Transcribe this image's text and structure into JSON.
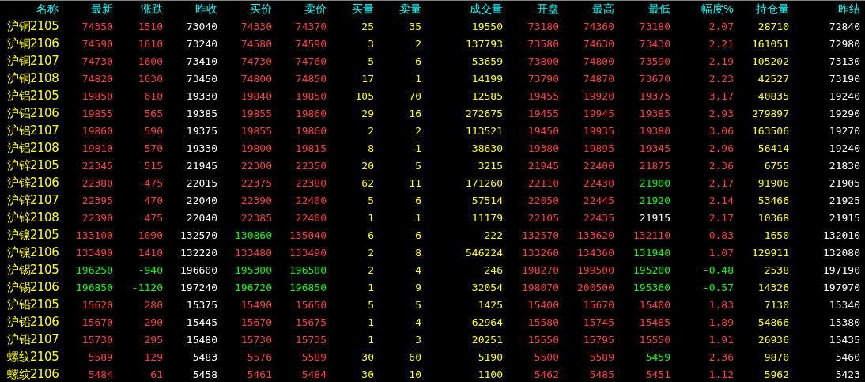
{
  "columns": [
    {
      "label": "名称"
    },
    {
      "label": "最新"
    },
    {
      "label": "涨跌"
    },
    {
      "label": "昨收"
    },
    {
      "label": "买价"
    },
    {
      "label": "卖价"
    },
    {
      "label": "买量"
    },
    {
      "label": "卖量"
    },
    {
      "label": "成交量"
    },
    {
      "label": "开盘"
    },
    {
      "label": "最高"
    },
    {
      "label": "最低"
    },
    {
      "label": "幅度%"
    },
    {
      "label": "持仓量"
    },
    {
      "label": "昨结"
    }
  ],
  "rows": [
    {
      "name": "沪铜2105",
      "cells": [
        {
          "text": "74350",
          "color": "#ff3c3c"
        },
        {
          "text": "1510",
          "color": "#ff3c3c"
        },
        {
          "text": "73040",
          "color": "#ffffff"
        },
        {
          "text": "74330",
          "color": "#ff3c3c"
        },
        {
          "text": "74370",
          "color": "#ff3c3c"
        },
        {
          "text": "25",
          "color": "#ffff00"
        },
        {
          "text": "35",
          "color": "#ffff00"
        },
        {
          "text": "19550",
          "color": "#ffff00"
        },
        {
          "text": "73180",
          "color": "#ff3c3c"
        },
        {
          "text": "74360",
          "color": "#ff3c3c"
        },
        {
          "text": "73180",
          "color": "#ff3c3c"
        },
        {
          "text": "2.07",
          "color": "#ff3c3c"
        },
        {
          "text": "28710",
          "color": "#ffff00"
        },
        {
          "text": "72840",
          "color": "#ffffff"
        }
      ]
    },
    {
      "name": "沪铜2106",
      "cells": [
        {
          "text": "74590",
          "color": "#ff3c3c"
        },
        {
          "text": "1610",
          "color": "#ff3c3c"
        },
        {
          "text": "73240",
          "color": "#ffffff"
        },
        {
          "text": "74580",
          "color": "#ff3c3c"
        },
        {
          "text": "74590",
          "color": "#ff3c3c"
        },
        {
          "text": "3",
          "color": "#ffff00"
        },
        {
          "text": "2",
          "color": "#ffff00"
        },
        {
          "text": "137793",
          "color": "#ffff00"
        },
        {
          "text": "73580",
          "color": "#ff3c3c"
        },
        {
          "text": "74630",
          "color": "#ff3c3c"
        },
        {
          "text": "73430",
          "color": "#ff3c3c"
        },
        {
          "text": "2.21",
          "color": "#ff3c3c"
        },
        {
          "text": "161051",
          "color": "#ffff00"
        },
        {
          "text": "72980",
          "color": "#ffffff"
        }
      ]
    },
    {
      "name": "沪铜2107",
      "cells": [
        {
          "text": "74730",
          "color": "#ff3c3c"
        },
        {
          "text": "1600",
          "color": "#ff3c3c"
        },
        {
          "text": "73410",
          "color": "#ffffff"
        },
        {
          "text": "74730",
          "color": "#ff3c3c"
        },
        {
          "text": "74760",
          "color": "#ff3c3c"
        },
        {
          "text": "5",
          "color": "#ffff00"
        },
        {
          "text": "6",
          "color": "#ffff00"
        },
        {
          "text": "53659",
          "color": "#ffff00"
        },
        {
          "text": "73800",
          "color": "#ff3c3c"
        },
        {
          "text": "74800",
          "color": "#ff3c3c"
        },
        {
          "text": "73590",
          "color": "#ff3c3c"
        },
        {
          "text": "2.19",
          "color": "#ff3c3c"
        },
        {
          "text": "105202",
          "color": "#ffff00"
        },
        {
          "text": "73130",
          "color": "#ffffff"
        }
      ]
    },
    {
      "name": "沪铜2108",
      "cells": [
        {
          "text": "74820",
          "color": "#ff3c3c"
        },
        {
          "text": "1630",
          "color": "#ff3c3c"
        },
        {
          "text": "73450",
          "color": "#ffffff"
        },
        {
          "text": "74800",
          "color": "#ff3c3c"
        },
        {
          "text": "74850",
          "color": "#ff3c3c"
        },
        {
          "text": "17",
          "color": "#ffff00"
        },
        {
          "text": "1",
          "color": "#ffff00"
        },
        {
          "text": "14199",
          "color": "#ffff00"
        },
        {
          "text": "73790",
          "color": "#ff3c3c"
        },
        {
          "text": "74870",
          "color": "#ff3c3c"
        },
        {
          "text": "73670",
          "color": "#ff3c3c"
        },
        {
          "text": "2.23",
          "color": "#ff3c3c"
        },
        {
          "text": "42527",
          "color": "#ffff00"
        },
        {
          "text": "73190",
          "color": "#ffffff"
        }
      ]
    },
    {
      "name": "沪铝2105",
      "cells": [
        {
          "text": "19850",
          "color": "#ff3c3c"
        },
        {
          "text": "610",
          "color": "#ff3c3c"
        },
        {
          "text": "19330",
          "color": "#ffffff"
        },
        {
          "text": "19840",
          "color": "#ff3c3c"
        },
        {
          "text": "19850",
          "color": "#ff3c3c"
        },
        {
          "text": "105",
          "color": "#ffff00"
        },
        {
          "text": "70",
          "color": "#ffff00"
        },
        {
          "text": "12585",
          "color": "#ffff00"
        },
        {
          "text": "19455",
          "color": "#ff3c3c"
        },
        {
          "text": "19920",
          "color": "#ff3c3c"
        },
        {
          "text": "19375",
          "color": "#ff3c3c"
        },
        {
          "text": "3.17",
          "color": "#ff3c3c"
        },
        {
          "text": "40835",
          "color": "#ffff00"
        },
        {
          "text": "19240",
          "color": "#ffffff"
        }
      ]
    },
    {
      "name": "沪铝2106",
      "cells": [
        {
          "text": "19855",
          "color": "#ff3c3c"
        },
        {
          "text": "565",
          "color": "#ff3c3c"
        },
        {
          "text": "19385",
          "color": "#ffffff"
        },
        {
          "text": "19855",
          "color": "#ff3c3c"
        },
        {
          "text": "19860",
          "color": "#ff3c3c"
        },
        {
          "text": "29",
          "color": "#ffff00"
        },
        {
          "text": "16",
          "color": "#ffff00"
        },
        {
          "text": "272675",
          "color": "#ffff00"
        },
        {
          "text": "19455",
          "color": "#ff3c3c"
        },
        {
          "text": "19945",
          "color": "#ff3c3c"
        },
        {
          "text": "19385",
          "color": "#ff3c3c"
        },
        {
          "text": "2.93",
          "color": "#ff3c3c"
        },
        {
          "text": "279897",
          "color": "#ffff00"
        },
        {
          "text": "19290",
          "color": "#ffffff"
        }
      ]
    },
    {
      "name": "沪铝2107",
      "cells": [
        {
          "text": "19860",
          "color": "#ff3c3c"
        },
        {
          "text": "590",
          "color": "#ff3c3c"
        },
        {
          "text": "19375",
          "color": "#ffffff"
        },
        {
          "text": "19855",
          "color": "#ff3c3c"
        },
        {
          "text": "19860",
          "color": "#ff3c3c"
        },
        {
          "text": "2",
          "color": "#ffff00"
        },
        {
          "text": "2",
          "color": "#ffff00"
        },
        {
          "text": "113521",
          "color": "#ffff00"
        },
        {
          "text": "19450",
          "color": "#ff3c3c"
        },
        {
          "text": "19935",
          "color": "#ff3c3c"
        },
        {
          "text": "19380",
          "color": "#ff3c3c"
        },
        {
          "text": "3.06",
          "color": "#ff3c3c"
        },
        {
          "text": "163506",
          "color": "#ffff00"
        },
        {
          "text": "19270",
          "color": "#ffffff"
        }
      ]
    },
    {
      "name": "沪铝2108",
      "cells": [
        {
          "text": "19810",
          "color": "#ff3c3c"
        },
        {
          "text": "570",
          "color": "#ff3c3c"
        },
        {
          "text": "19330",
          "color": "#ffffff"
        },
        {
          "text": "19800",
          "color": "#ff3c3c"
        },
        {
          "text": "19815",
          "color": "#ff3c3c"
        },
        {
          "text": "8",
          "color": "#ffff00"
        },
        {
          "text": "1",
          "color": "#ffff00"
        },
        {
          "text": "38630",
          "color": "#ffff00"
        },
        {
          "text": "19380",
          "color": "#ff3c3c"
        },
        {
          "text": "19895",
          "color": "#ff3c3c"
        },
        {
          "text": "19345",
          "color": "#ff3c3c"
        },
        {
          "text": "2.96",
          "color": "#ff3c3c"
        },
        {
          "text": "56414",
          "color": "#ffff00"
        },
        {
          "text": "19240",
          "color": "#ffffff"
        }
      ]
    },
    {
      "name": "沪锌2105",
      "cells": [
        {
          "text": "22345",
          "color": "#ff3c3c"
        },
        {
          "text": "515",
          "color": "#ff3c3c"
        },
        {
          "text": "21945",
          "color": "#ffffff"
        },
        {
          "text": "22300",
          "color": "#ff3c3c"
        },
        {
          "text": "22350",
          "color": "#ff3c3c"
        },
        {
          "text": "20",
          "color": "#ffff00"
        },
        {
          "text": "5",
          "color": "#ffff00"
        },
        {
          "text": "3215",
          "color": "#ffff00"
        },
        {
          "text": "21945",
          "color": "#ff3c3c"
        },
        {
          "text": "22400",
          "color": "#ff3c3c"
        },
        {
          "text": "21875",
          "color": "#ff3c3c"
        },
        {
          "text": "2.36",
          "color": "#ff3c3c"
        },
        {
          "text": "6755",
          "color": "#ffff00"
        },
        {
          "text": "21830",
          "color": "#ffffff"
        }
      ]
    },
    {
      "name": "沪锌2106",
      "cells": [
        {
          "text": "22380",
          "color": "#ff3c3c"
        },
        {
          "text": "475",
          "color": "#ff3c3c"
        },
        {
          "text": "22015",
          "color": "#ffffff"
        },
        {
          "text": "22375",
          "color": "#ff3c3c"
        },
        {
          "text": "22380",
          "color": "#ff3c3c"
        },
        {
          "text": "62",
          "color": "#ffff00"
        },
        {
          "text": "11",
          "color": "#ffff00"
        },
        {
          "text": "171260",
          "color": "#ffff00"
        },
        {
          "text": "22110",
          "color": "#ff3c3c"
        },
        {
          "text": "22430",
          "color": "#ff3c3c"
        },
        {
          "text": "21900",
          "color": "#00ff00"
        },
        {
          "text": "2.17",
          "color": "#ff3c3c"
        },
        {
          "text": "91906",
          "color": "#ffff00"
        },
        {
          "text": "21905",
          "color": "#ffffff"
        }
      ]
    },
    {
      "name": "沪锌2107",
      "cells": [
        {
          "text": "22395",
          "color": "#ff3c3c"
        },
        {
          "text": "470",
          "color": "#ff3c3c"
        },
        {
          "text": "22040",
          "color": "#ffffff"
        },
        {
          "text": "22390",
          "color": "#ff3c3c"
        },
        {
          "text": "22400",
          "color": "#ff3c3c"
        },
        {
          "text": "5",
          "color": "#ffff00"
        },
        {
          "text": "6",
          "color": "#ffff00"
        },
        {
          "text": "57514",
          "color": "#ffff00"
        },
        {
          "text": "22050",
          "color": "#ff3c3c"
        },
        {
          "text": "22445",
          "color": "#ff3c3c"
        },
        {
          "text": "21920",
          "color": "#00ff00"
        },
        {
          "text": "2.14",
          "color": "#ff3c3c"
        },
        {
          "text": "53466",
          "color": "#ffff00"
        },
        {
          "text": "21925",
          "color": "#ffffff"
        }
      ]
    },
    {
      "name": "沪锌2108",
      "cells": [
        {
          "text": "22390",
          "color": "#ff3c3c"
        },
        {
          "text": "475",
          "color": "#ff3c3c"
        },
        {
          "text": "22040",
          "color": "#ffffff"
        },
        {
          "text": "22385",
          "color": "#ff3c3c"
        },
        {
          "text": "22400",
          "color": "#ff3c3c"
        },
        {
          "text": "1",
          "color": "#ffff00"
        },
        {
          "text": "1",
          "color": "#ffff00"
        },
        {
          "text": "11179",
          "color": "#ffff00"
        },
        {
          "text": "22105",
          "color": "#ff3c3c"
        },
        {
          "text": "22435",
          "color": "#ff3c3c"
        },
        {
          "text": "21915",
          "color": "#ffffff"
        },
        {
          "text": "2.17",
          "color": "#ff3c3c"
        },
        {
          "text": "10368",
          "color": "#ffff00"
        },
        {
          "text": "21915",
          "color": "#ffffff"
        }
      ]
    },
    {
      "name": "沪镍2105",
      "cells": [
        {
          "text": "133100",
          "color": "#ff3c3c"
        },
        {
          "text": "1090",
          "color": "#ff3c3c"
        },
        {
          "text": "132570",
          "color": "#ffffff"
        },
        {
          "text": "130860",
          "color": "#00ff00"
        },
        {
          "text": "135040",
          "color": "#ff3c3c"
        },
        {
          "text": "6",
          "color": "#ffff00"
        },
        {
          "text": "6",
          "color": "#ffff00"
        },
        {
          "text": "222",
          "color": "#ffff00"
        },
        {
          "text": "132570",
          "color": "#ff3c3c"
        },
        {
          "text": "133620",
          "color": "#ff3c3c"
        },
        {
          "text": "132110",
          "color": "#ff3c3c"
        },
        {
          "text": "0.83",
          "color": "#ff3c3c"
        },
        {
          "text": "1650",
          "color": "#ffff00"
        },
        {
          "text": "132010",
          "color": "#ffffff"
        }
      ]
    },
    {
      "name": "沪镍2106",
      "cells": [
        {
          "text": "133490",
          "color": "#ff3c3c"
        },
        {
          "text": "1410",
          "color": "#ff3c3c"
        },
        {
          "text": "132220",
          "color": "#ffffff"
        },
        {
          "text": "133480",
          "color": "#ff3c3c"
        },
        {
          "text": "133490",
          "color": "#ff3c3c"
        },
        {
          "text": "2",
          "color": "#ffff00"
        },
        {
          "text": "8",
          "color": "#ffff00"
        },
        {
          "text": "546224",
          "color": "#ffff00"
        },
        {
          "text": "133260",
          "color": "#ff3c3c"
        },
        {
          "text": "134360",
          "color": "#ff3c3c"
        },
        {
          "text": "131940",
          "color": "#00ff00"
        },
        {
          "text": "1.07",
          "color": "#ff3c3c"
        },
        {
          "text": "129911",
          "color": "#ffff00"
        },
        {
          "text": "132080",
          "color": "#ffffff"
        }
      ]
    },
    {
      "name": "沪锡2105",
      "cells": [
        {
          "text": "196250",
          "color": "#00ff00"
        },
        {
          "text": "-940",
          "color": "#00ff00"
        },
        {
          "text": "196600",
          "color": "#ffffff"
        },
        {
          "text": "195300",
          "color": "#00ff00"
        },
        {
          "text": "196500",
          "color": "#00ff00"
        },
        {
          "text": "2",
          "color": "#ffff00"
        },
        {
          "text": "4",
          "color": "#ffff00"
        },
        {
          "text": "246",
          "color": "#ffff00"
        },
        {
          "text": "198270",
          "color": "#ff3c3c"
        },
        {
          "text": "199500",
          "color": "#ff3c3c"
        },
        {
          "text": "195200",
          "color": "#00ff00"
        },
        {
          "text": "-0.48",
          "color": "#00ff00"
        },
        {
          "text": "2538",
          "color": "#ffff00"
        },
        {
          "text": "197190",
          "color": "#ffffff"
        }
      ]
    },
    {
      "name": "沪锡2106",
      "cells": [
        {
          "text": "196850",
          "color": "#00ff00"
        },
        {
          "text": "-1120",
          "color": "#00ff00"
        },
        {
          "text": "197240",
          "color": "#ffffff"
        },
        {
          "text": "196720",
          "color": "#00ff00"
        },
        {
          "text": "196850",
          "color": "#00ff00"
        },
        {
          "text": "1",
          "color": "#ffff00"
        },
        {
          "text": "9",
          "color": "#ffff00"
        },
        {
          "text": "32054",
          "color": "#ffff00"
        },
        {
          "text": "198070",
          "color": "#ff3c3c"
        },
        {
          "text": "200500",
          "color": "#ff3c3c"
        },
        {
          "text": "195360",
          "color": "#00ff00"
        },
        {
          "text": "-0.57",
          "color": "#00ff00"
        },
        {
          "text": "14326",
          "color": "#ffff00"
        },
        {
          "text": "197970",
          "color": "#ffffff"
        }
      ]
    },
    {
      "name": "沪铅2105",
      "cells": [
        {
          "text": "15620",
          "color": "#ff3c3c"
        },
        {
          "text": "280",
          "color": "#ff3c3c"
        },
        {
          "text": "15375",
          "color": "#ffffff"
        },
        {
          "text": "15490",
          "color": "#ff3c3c"
        },
        {
          "text": "15650",
          "color": "#ff3c3c"
        },
        {
          "text": "5",
          "color": "#ffff00"
        },
        {
          "text": "5",
          "color": "#ffff00"
        },
        {
          "text": "1425",
          "color": "#ffff00"
        },
        {
          "text": "15400",
          "color": "#ff3c3c"
        },
        {
          "text": "15670",
          "color": "#ff3c3c"
        },
        {
          "text": "15400",
          "color": "#ff3c3c"
        },
        {
          "text": "1.83",
          "color": "#ff3c3c"
        },
        {
          "text": "7130",
          "color": "#ffff00"
        },
        {
          "text": "15340",
          "color": "#ffffff"
        }
      ]
    },
    {
      "name": "沪铅2106",
      "cells": [
        {
          "text": "15670",
          "color": "#ff3c3c"
        },
        {
          "text": "290",
          "color": "#ff3c3c"
        },
        {
          "text": "15445",
          "color": "#ffffff"
        },
        {
          "text": "15670",
          "color": "#ff3c3c"
        },
        {
          "text": "15675",
          "color": "#ff3c3c"
        },
        {
          "text": "1",
          "color": "#ffff00"
        },
        {
          "text": "4",
          "color": "#ffff00"
        },
        {
          "text": "62964",
          "color": "#ffff00"
        },
        {
          "text": "15580",
          "color": "#ff3c3c"
        },
        {
          "text": "15745",
          "color": "#ff3c3c"
        },
        {
          "text": "15485",
          "color": "#ff3c3c"
        },
        {
          "text": "1.89",
          "color": "#ff3c3c"
        },
        {
          "text": "54866",
          "color": "#ffff00"
        },
        {
          "text": "15380",
          "color": "#ffffff"
        }
      ]
    },
    {
      "name": "沪铅2107",
      "cells": [
        {
          "text": "15730",
          "color": "#ff3c3c"
        },
        {
          "text": "295",
          "color": "#ff3c3c"
        },
        {
          "text": "15480",
          "color": "#ffffff"
        },
        {
          "text": "15730",
          "color": "#ff3c3c"
        },
        {
          "text": "15735",
          "color": "#ff3c3c"
        },
        {
          "text": "1",
          "color": "#ffff00"
        },
        {
          "text": "3",
          "color": "#ffff00"
        },
        {
          "text": "20251",
          "color": "#ffff00"
        },
        {
          "text": "15550",
          "color": "#ff3c3c"
        },
        {
          "text": "15795",
          "color": "#ff3c3c"
        },
        {
          "text": "15550",
          "color": "#ff3c3c"
        },
        {
          "text": "1.91",
          "color": "#ff3c3c"
        },
        {
          "text": "26936",
          "color": "#ffff00"
        },
        {
          "text": "15435",
          "color": "#ffffff"
        }
      ]
    },
    {
      "name": "螺纹2105",
      "cells": [
        {
          "text": "5589",
          "color": "#ff3c3c"
        },
        {
          "text": "129",
          "color": "#ff3c3c"
        },
        {
          "text": "5483",
          "color": "#ffffff"
        },
        {
          "text": "5576",
          "color": "#ff3c3c"
        },
        {
          "text": "5589",
          "color": "#ff3c3c"
        },
        {
          "text": "30",
          "color": "#ffff00"
        },
        {
          "text": "60",
          "color": "#ffff00"
        },
        {
          "text": "5190",
          "color": "#ffff00"
        },
        {
          "text": "5500",
          "color": "#ff3c3c"
        },
        {
          "text": "5589",
          "color": "#ff3c3c"
        },
        {
          "text": "5459",
          "color": "#00ff00"
        },
        {
          "text": "2.36",
          "color": "#ff3c3c"
        },
        {
          "text": "9870",
          "color": "#ffff00"
        },
        {
          "text": "5460",
          "color": "#ffffff"
        }
      ]
    },
    {
      "name": "螺纹2106",
      "cells": [
        {
          "text": "5484",
          "color": "#ff3c3c"
        },
        {
          "text": "61",
          "color": "#ff3c3c"
        },
        {
          "text": "5458",
          "color": "#ffffff"
        },
        {
          "text": "5461",
          "color": "#ff3c3c"
        },
        {
          "text": "5484",
          "color": "#ff3c3c"
        },
        {
          "text": "30",
          "color": "#ffff00"
        },
        {
          "text": "10",
          "color": "#ffff00"
        },
        {
          "text": "1100",
          "color": "#ffff00"
        },
        {
          "text": "5462",
          "color": "#ff3c3c"
        },
        {
          "text": "5485",
          "color": "#ff3c3c"
        },
        {
          "text": "5451",
          "color": "#ff3c3c"
        },
        {
          "text": "1.12",
          "color": "#ff3c3c"
        },
        {
          "text": "5962",
          "color": "#ffff00"
        },
        {
          "text": "5423",
          "color": "#ffffff"
        }
      ]
    }
  ]
}
